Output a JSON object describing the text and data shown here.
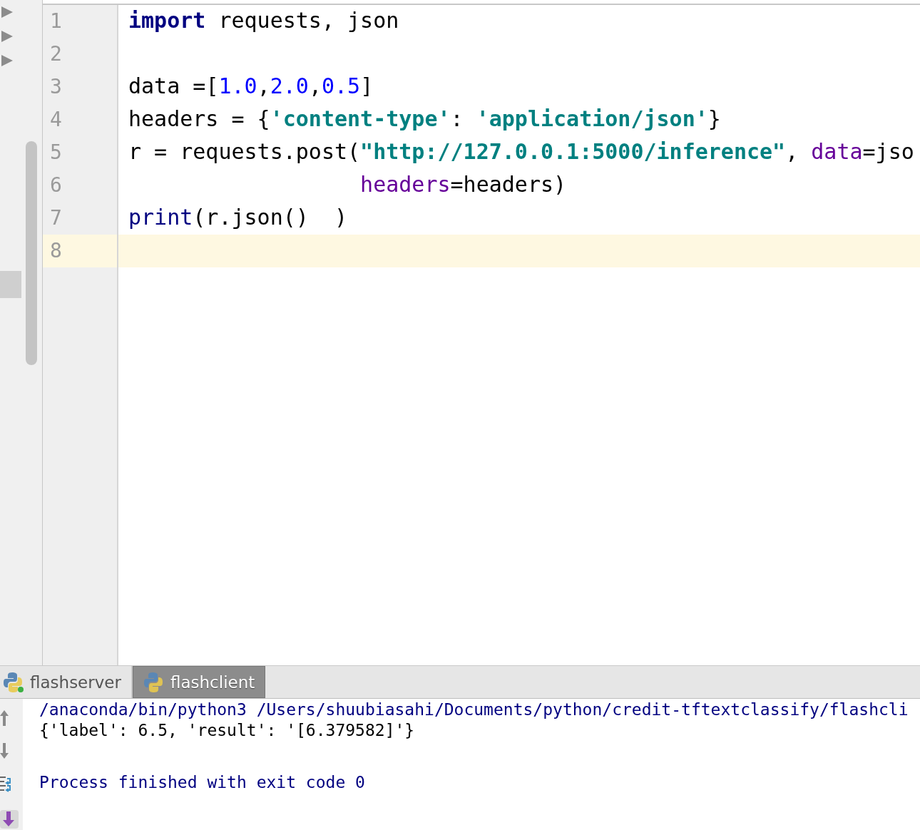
{
  "editor": {
    "lines": [
      {
        "number": "1",
        "current": false,
        "tokens": [
          {
            "kind": "keyword",
            "text": "import"
          },
          {
            "kind": "plain",
            "text": " requests, json"
          }
        ]
      },
      {
        "number": "2",
        "current": false
      },
      {
        "number": "3",
        "current": false,
        "tokens": [
          {
            "kind": "plain",
            "text": "data ="
          },
          {
            "kind": "plain",
            "text": "["
          },
          {
            "kind": "number",
            "text": "1.0"
          },
          {
            "kind": "plain",
            "text": ","
          },
          {
            "kind": "number",
            "text": "2.0"
          },
          {
            "kind": "plain",
            "text": ","
          },
          {
            "kind": "number",
            "text": "0.5"
          },
          {
            "kind": "plain",
            "text": "]"
          }
        ]
      },
      {
        "number": "4",
        "current": false,
        "tokens": [
          {
            "kind": "plain",
            "text": "headers = {"
          },
          {
            "kind": "string",
            "text": "'content-type'"
          },
          {
            "kind": "plain",
            "text": ": "
          },
          {
            "kind": "string",
            "text": "'application/json'"
          },
          {
            "kind": "plain",
            "text": "}"
          }
        ]
      },
      {
        "number": "5",
        "current": false,
        "tokens": [
          {
            "kind": "plain",
            "text": "r = requests.post("
          },
          {
            "kind": "string",
            "text": "\"http://127.0.0.1:5000/inference\""
          },
          {
            "kind": "plain",
            "text": ", "
          },
          {
            "kind": "param",
            "text": "data"
          },
          {
            "kind": "plain",
            "text": "=jso"
          }
        ]
      },
      {
        "number": "6",
        "current": false,
        "continuation": true,
        "tokens": [
          {
            "kind": "param",
            "text": "headers"
          },
          {
            "kind": "plain",
            "text": "=headers)"
          }
        ]
      },
      {
        "number": "7",
        "current": false,
        "tokens": [
          {
            "kind": "builtin",
            "text": "print"
          },
          {
            "kind": "plain",
            "text": "(r.json()  )"
          }
        ]
      },
      {
        "number": "8",
        "current": true
      }
    ]
  },
  "run_tabs": [
    {
      "label": "flashserver",
      "selected": false,
      "running": true
    },
    {
      "label": "flashclient",
      "selected": true,
      "running": false
    }
  ],
  "console": {
    "lines": [
      {
        "kind": "command",
        "text": "/anaconda/bin/python3 /Users/shuubiasahi/Documents/python/credit-tftextclassify/flashcli"
      },
      {
        "kind": "output",
        "text": "{'label': 6.5, 'result': '[6.379582]'}"
      },
      {
        "kind": "status",
        "text": "Process finished with exit code 0"
      }
    ]
  }
}
